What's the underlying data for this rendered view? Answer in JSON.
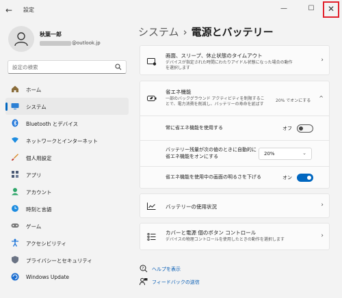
{
  "window": {
    "title": "設定",
    "back_glyph": "←",
    "minimize_glyph": "—",
    "maximize_glyph": "☐",
    "close_glyph": "✕"
  },
  "profile": {
    "name": "秋葉一郎",
    "email_domain": "@outlook.jp"
  },
  "search": {
    "placeholder": "設定の検索"
  },
  "nav": [
    {
      "label": "ホーム",
      "icon": "home-icon"
    },
    {
      "label": "システム",
      "icon": "system-icon",
      "active": true
    },
    {
      "label": "Bluetooth とデバイス",
      "icon": "bluetooth-icon"
    },
    {
      "label": "ネットワークとインターネット",
      "icon": "network-icon"
    },
    {
      "label": "個人用設定",
      "icon": "brush-icon"
    },
    {
      "label": "アプリ",
      "icon": "apps-icon"
    },
    {
      "label": "アカウント",
      "icon": "account-icon"
    },
    {
      "label": "時刻と言語",
      "icon": "time-language-icon"
    },
    {
      "label": "ゲーム",
      "icon": "gaming-icon"
    },
    {
      "label": "アクセシビリティ",
      "icon": "accessibility-icon"
    },
    {
      "label": "プライバシーとセキュリティ",
      "icon": "shield-icon"
    },
    {
      "label": "Windows Update",
      "icon": "windows-update-icon"
    }
  ],
  "header": {
    "parent": "システム",
    "separator": "›",
    "current": "電源とバッテリー"
  },
  "cards": {
    "screen_sleep": {
      "title": "画面、スリープ、休止状態のタイムアウト",
      "desc": "デバイスが指定された時間にわたりアイドル状態になった場合の動作を選択します",
      "chevron": "›"
    },
    "energy_saver": {
      "title": "省エネ機能",
      "desc": "一部のバックグラウンド アクティビティを制限することで、電力消費を削減し、バッテリーの寿命を延ばす",
      "status": "20% でオンにする",
      "chevron": "^"
    },
    "always_on": {
      "label": "常に省エネ機能を使用する",
      "state": "オフ"
    },
    "auto_on": {
      "label": "バッテリー残量が次の値のときに自動的に省エネ機能をオンにする",
      "value": "20%",
      "chevron": "⌄"
    },
    "lower_brightness": {
      "label": "省エネ機能を使用中の画面の明るさを下げる",
      "state": "オン"
    },
    "battery_usage": {
      "title": "バッテリーの使用状況",
      "chevron": "›"
    },
    "lid_power": {
      "title": "カバーと電源 個のボタン コントロール",
      "desc": "デバイスの物理コントロールを使用したときの動作を選択します",
      "chevron": "›"
    }
  },
  "links": {
    "help": "ヘルプを表示",
    "feedback": "フィードバックの送信"
  },
  "colors": {
    "accent": "#0067c0",
    "close_highlight": "#e1212c"
  }
}
